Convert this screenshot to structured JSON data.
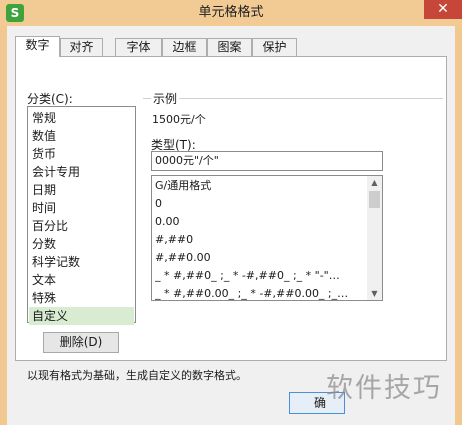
{
  "window": {
    "title": "单元格格式",
    "app_icon_letter": "S",
    "close_glyph": "✕",
    "brand_color": "#3fa33d",
    "title_bar_color": "#f2cb94",
    "close_color": "#c7463a"
  },
  "tabs": [
    {
      "label": "数字",
      "active": true
    },
    {
      "label": "对齐",
      "active": false
    },
    {
      "label": "字体",
      "active": false
    },
    {
      "label": "边框",
      "active": false
    },
    {
      "label": "图案",
      "active": false
    },
    {
      "label": "保护",
      "active": false
    }
  ],
  "category": {
    "label": "分类(C):",
    "items": [
      "常规",
      "数值",
      "货币",
      "会计专用",
      "日期",
      "时间",
      "百分比",
      "分数",
      "科学记数",
      "文本",
      "特殊",
      "自定义"
    ],
    "selected": "自定义",
    "selected_color": "#d8ecd2"
  },
  "sample": {
    "legend": "示例",
    "value": "1500元/个"
  },
  "type": {
    "label": "类型(T):",
    "value": "0000元\"/个\""
  },
  "formats": {
    "items": [
      "G/通用格式",
      "0",
      "0.00",
      "#,##0",
      "#,##0.00",
      "_ * #,##0_ ;_ * -#,##0_ ;_ * \"-\"…",
      "_ * #,##0.00_ ;_ * -#,##0.00_ ;_…"
    ],
    "scroll_up_icon": "scroll-up-arrow-icon",
    "scroll_down_icon": "scroll-down-arrow-icon"
  },
  "buttons": {
    "delete": "删除(D)",
    "ok": "确"
  },
  "description": "以现有格式为基础，生成自定义的数字格式。",
  "watermark": "软件技巧"
}
